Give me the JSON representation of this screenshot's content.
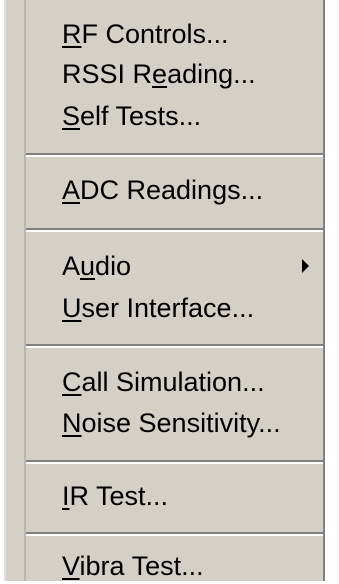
{
  "menu": {
    "items": [
      {
        "pre": "",
        "accel": "R",
        "post": "F Controls..."
      },
      {
        "pre": "RSSI R",
        "accel": "e",
        "post": "ading..."
      },
      {
        "pre": "",
        "accel": "S",
        "post": "elf Tests..."
      },
      {
        "pre": "",
        "accel": "A",
        "post": "DC Readings..."
      },
      {
        "pre": "A",
        "accel": "u",
        "post": "dio",
        "submenu_icon": "submenu-arrow-icon"
      },
      {
        "pre": "",
        "accel": "U",
        "post": "ser Interface..."
      },
      {
        "pre": "",
        "accel": "C",
        "post": "all Simulation..."
      },
      {
        "pre": "",
        "accel": "N",
        "post": "oise Sensitivity..."
      },
      {
        "pre": "",
        "accel": "I",
        "post": "R Test..."
      },
      {
        "pre": "",
        "accel": "V",
        "post": "ibra Test..."
      }
    ]
  }
}
